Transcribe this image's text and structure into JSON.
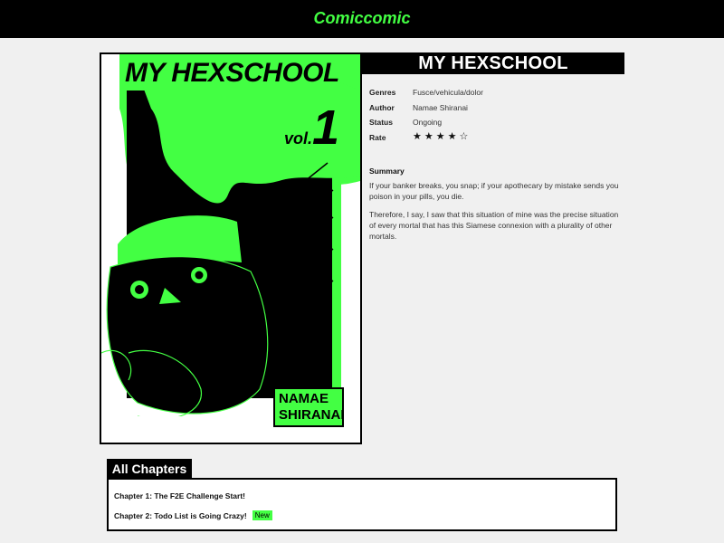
{
  "header": {
    "brand": "Comiccomic"
  },
  "cover": {
    "title_line": "MY HEXSCHOOL",
    "volume_prefix": "vol.",
    "volume_number": "1",
    "author_line1": "NAMAE",
    "author_line2": "SHIRANAI",
    "accent_color": "#43ff43"
  },
  "comic": {
    "title": "MY HEXSCHOOL",
    "details": [
      {
        "label": "Genres",
        "value": "Fusce/vehicula/dolor"
      },
      {
        "label": "Author",
        "value": "Namae Shiranai"
      },
      {
        "label": "Status",
        "value": "Ongoing"
      },
      {
        "label": "Rate",
        "value": ""
      }
    ],
    "rating": 4,
    "rating_max": 5,
    "summary_title": "Summary",
    "summary_paragraphs": [
      "If your banker breaks, you snap; if your apothecary by mistake sends you poison in your pills, you die.",
      "Therefore, I say, I saw that this situation of mine was the precise situation of every mortal that has this Siamese connexion with a plurality of other mortals."
    ]
  },
  "chapters": {
    "heading": "All Chapters",
    "items": [
      {
        "label": "Chapter 1: The F2E Challenge Start!",
        "badge": ""
      },
      {
        "label": "Chapter 2: Todo List is Going Crazy!",
        "badge": "New"
      }
    ]
  }
}
